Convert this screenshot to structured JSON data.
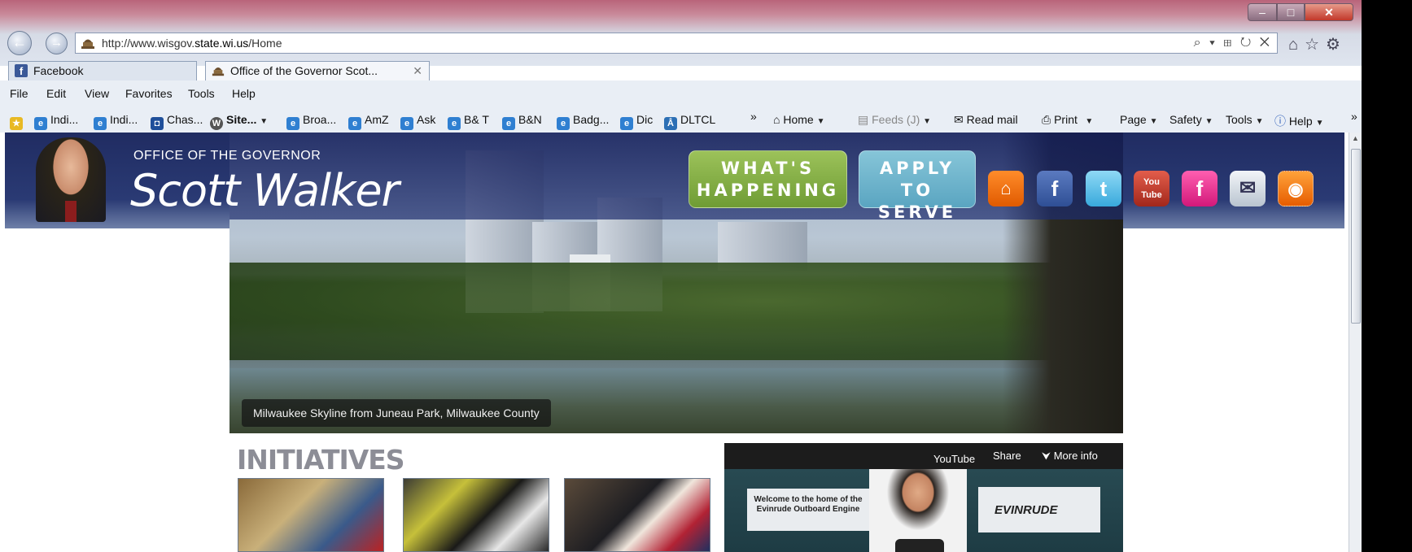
{
  "browser": {
    "address": {
      "prefix": "http://www.wisgov.",
      "host": "state.wi.us",
      "suffix": "/Home",
      "tools": "⌕ ▾ ⊞ ↻ ✕"
    },
    "right_icons": "⌂☆⚙",
    "window_controls": {
      "min": "‒",
      "max": "□",
      "close": "✕"
    },
    "tabs": [
      {
        "label": "Facebook",
        "icon": "facebook-icon"
      },
      {
        "label": "Office of the Governor Scot...",
        "icon": "capitol-icon",
        "close": "✕"
      }
    ],
    "menu": [
      "File",
      "Edit",
      "View",
      "Favorites",
      "Tools",
      "Help"
    ],
    "favorites": [
      {
        "label": "Indi...",
        "icon": "ie-page-icon"
      },
      {
        "label": "Indi...",
        "icon": "ie-page-icon"
      },
      {
        "label": "Chas...",
        "icon": "chase-icon"
      },
      {
        "label": "Site...",
        "icon": "wordpress-icon"
      },
      {
        "label": "Broa...",
        "icon": "ie-page-icon"
      },
      {
        "label": "AmZ",
        "icon": "ie-page-icon"
      },
      {
        "label": "Ask",
        "icon": "ie-page-icon"
      },
      {
        "label": "B& T",
        "icon": "ie-page-icon"
      },
      {
        "label": "B&N",
        "icon": "ie-page-icon"
      },
      {
        "label": "Badg...",
        "icon": "ie-page-icon"
      },
      {
        "label": "Dic",
        "icon": "ie-page-icon"
      },
      {
        "label": "DLTCL",
        "icon": "dltcl-icon"
      }
    ],
    "chevron": "»",
    "commands": [
      "Home",
      "Feeds (J)",
      "Read mail",
      "Print",
      "Page",
      "Safety",
      "Tools",
      "Help"
    ]
  },
  "site": {
    "office_label": "OFFICE OF THE GOVERNOR",
    "name": "Scott Walker",
    "buttons": {
      "happening_line1": "WHAT'S",
      "happening_line2": "HAPPENING",
      "serve_line1": "APPLY TO",
      "serve_line2": "SERVE"
    },
    "social": {
      "home": "⌂",
      "facebook": "f",
      "twitter": "t",
      "youtube_top": "You",
      "youtube_bottom": "Tube",
      "facebook_page": "f",
      "mail": "✉",
      "rss": "◉"
    },
    "banner_caption": "Milwaukee Skyline from Juneau Park, Milwaukee County",
    "initiatives_title": "INITIATIVES",
    "video": {
      "youtube_label": "YouTube",
      "share_label": "Share",
      "more_info_label": "More info",
      "sign_text": "Welcome to the home of the Evinrude Outboard Engine",
      "logo_text": "EVINRUDE"
    }
  }
}
